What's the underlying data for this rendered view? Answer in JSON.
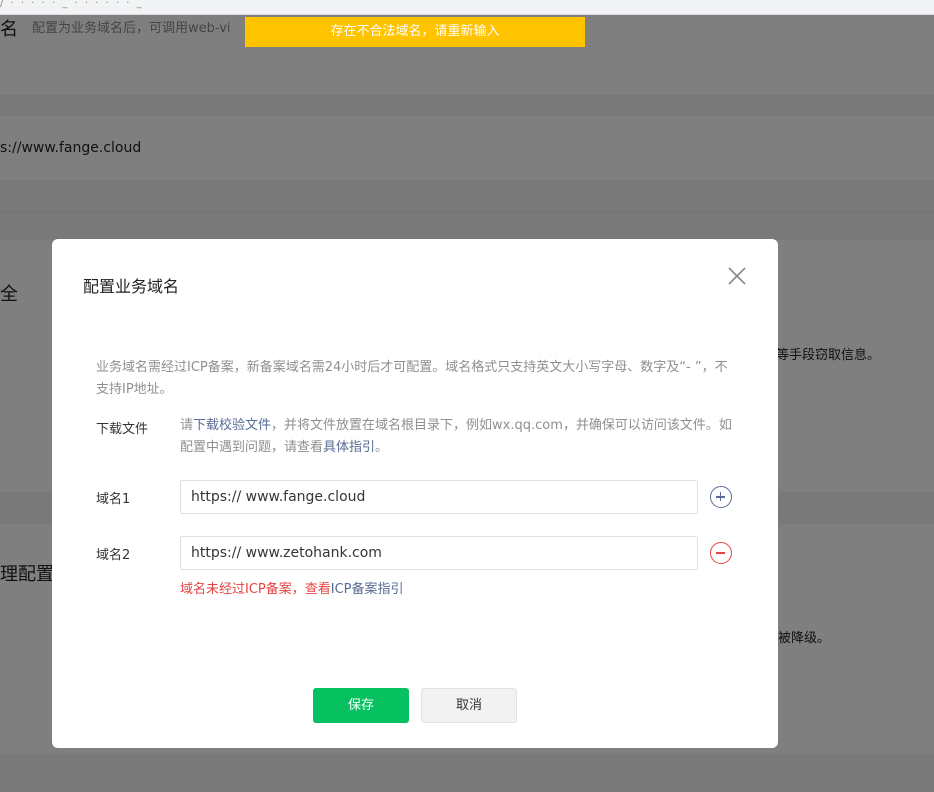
{
  "browser": {
    "url_fragment": "/ ·  · ·  · ·  _ ·  ·  ·  ·  ·  ·   _"
  },
  "background": {
    "section_title_partial": "名",
    "section_desc_partial": "配置为业务域名后，可调用web-vi",
    "domain_value_partial": "s://www.fange.cloud",
    "section2_title_partial": "全",
    "section2_note_partial": "等手段窃取信息。",
    "section3_title_partial": "理配置",
    "section3_note_partial": "被降级。"
  },
  "toast": {
    "message": "存在不合法域名，请重新输入",
    "color": "#ffc300"
  },
  "dialog": {
    "title": "配置业务域名",
    "description": "业务域名需经过ICP备案，新备案域名需24小时后才可配置。域名格式只支持英文大小写字母、数字及“- ”，不支持IP地址。",
    "download": {
      "label": "下载文件",
      "tip_before": "请",
      "tip_link": "下载校验文件",
      "tip_middle": "，并将文件放置在域名根目录下，例如wx.qq.com，并确保可以访问该文件。如配置中遇到问题，请查看",
      "tip_link2": "具体指引",
      "tip_end": "。"
    },
    "domains": [
      {
        "label": "域名1",
        "value": "https:// www.fange.cloud",
        "action_icon": "plus-circle-icon"
      },
      {
        "label": "域名2",
        "value": "https:// www.zetohank.com",
        "action_icon": "minus-circle-icon"
      }
    ],
    "error": {
      "text": "域名未经过ICP备案，查看",
      "link": "ICP备案指引",
      "color": "#e64340"
    },
    "buttons": {
      "save": "保存",
      "cancel": "取消"
    },
    "colors": {
      "primary": "#07c160",
      "link": "#576b95"
    }
  }
}
